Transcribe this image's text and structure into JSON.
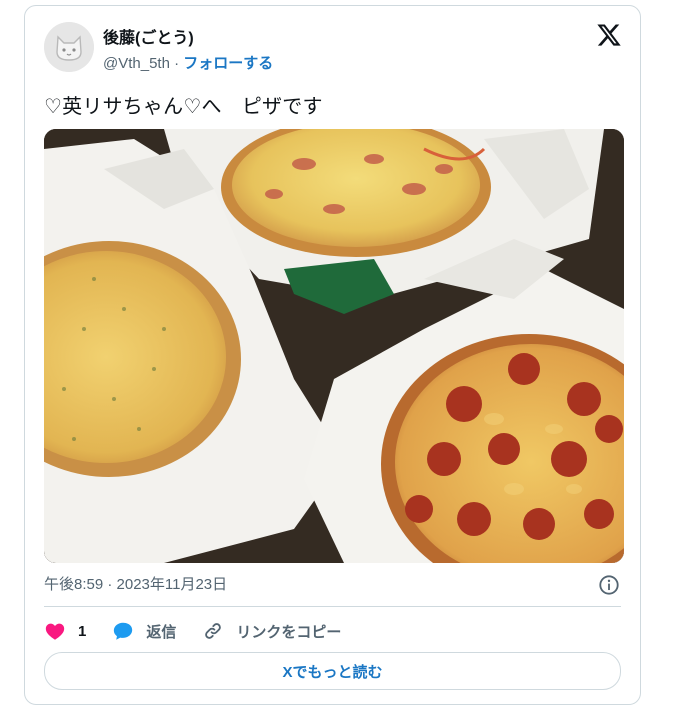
{
  "author": {
    "display_name": "後藤(ごとう)",
    "handle": "@Vth_5th",
    "separator": "·",
    "follow_label": "フォローする",
    "avatar_icon": "cat-face-icon"
  },
  "platform": {
    "logo_icon": "x-logo-icon"
  },
  "tweet": {
    "text": "♡英リサちゃん♡へ　ピザです",
    "image_alt_subject": "three pizzas in open delivery boxes",
    "timestamp": "午後8:59 · 2023年11月23日"
  },
  "actions": {
    "like_count": "1",
    "reply_label": "返信",
    "copy_link_label": "リンクをコピー"
  },
  "read_more_label": "Xでもっと読む",
  "colors": {
    "accent": "#1d9bf0",
    "like": "#f91880",
    "text": "#0f1419",
    "muted": "#536471"
  }
}
